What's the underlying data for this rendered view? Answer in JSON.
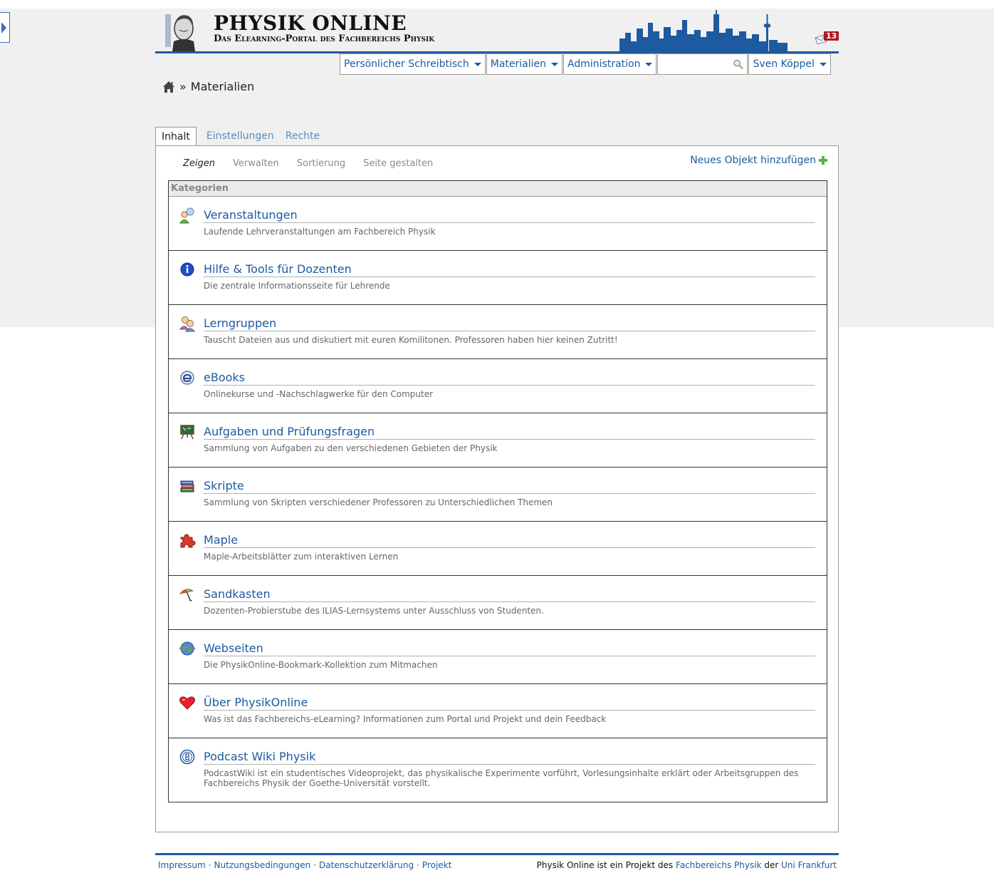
{
  "header": {
    "title": "PHYSIK ONLINE",
    "subtitle": "Das Elearning-Portal des Fachbereichs Physik",
    "mail_count": "13"
  },
  "mainmenu": {
    "desk": "Persönlicher Schreibtisch",
    "materials": "Materialien",
    "admin": "Administration",
    "search_value": "",
    "user": "Sven Köppel"
  },
  "breadcrumb": {
    "sep": "»",
    "current": "Materialien"
  },
  "tabs": [
    {
      "label": "Inhalt"
    },
    {
      "label": "Einstellungen"
    },
    {
      "label": "Rechte"
    }
  ],
  "subtabs": [
    {
      "label": "Zeigen"
    },
    {
      "label": "Verwalten"
    },
    {
      "label": "Sortierung"
    },
    {
      "label": "Seite gestalten"
    }
  ],
  "new_object": "Neues Objekt hinzufügen",
  "categories_header": "Kategorien",
  "categories": [
    {
      "title": "Veranstaltungen",
      "desc": "Laufende Lehrveranstaltungen am Fachbereich Physik",
      "icon": "course-users-icon"
    },
    {
      "title": "Hilfe & Tools für Dozenten",
      "desc": "Die zentrale Informationsseite für Lehrende",
      "icon": "info-icon"
    },
    {
      "title": "Lerngruppen",
      "desc": "Tauscht Dateien aus und diskutiert mit euren Komilitonen. Professoren haben hier keinen Zutritt!",
      "icon": "group-icon"
    },
    {
      "title": "eBooks",
      "desc": "Onlinekurse und -Nachschlagwerke für den Computer",
      "icon": "ebook-icon"
    },
    {
      "title": "Aufgaben und Prüfungsfragen",
      "desc": "Sammlung von Aufgaben zu den verschiedenen Gebieten der Physik",
      "icon": "chalkboard-icon"
    },
    {
      "title": "Skripte",
      "desc": "Sammlung von Skripten verschiedener Professoren zu Unterschiedlichen Themen",
      "icon": "books-icon"
    },
    {
      "title": "Maple",
      "desc": "Maple-Arbeitsblätter zum interaktiven Lernen",
      "icon": "puzzle-icon"
    },
    {
      "title": "Sandkasten",
      "desc": "Dozenten-Probierstube des ILIAS-Lernsystems unter Ausschluss von Studenten.",
      "icon": "umbrella-icon"
    },
    {
      "title": "Webseiten",
      "desc": "Die PhysikOnline-Bookmark-Kollektion zum Mitmachen",
      "icon": "globe-icon"
    },
    {
      "title": "Über PhysikOnline",
      "desc": "Was ist das Fachbereichs-eLearning? Informationen zum Portal und Projekt und dein Feedback",
      "icon": "heart-icon"
    },
    {
      "title": "Podcast Wiki Physik",
      "desc": "PodcastWiki ist ein studentisches Videoprojekt, das physikalische Experimente vorführt, Vorlesungsinhalte erklärt oder Arbeitsgruppen des Fachbereichs Physik der Goethe-Universität vorstellt.",
      "icon": "podcast-icon"
    }
  ],
  "footer": {
    "links": [
      "Impressum",
      "Nutzungsbedingungen",
      "Datenschutzerklärung",
      "Projekt"
    ],
    "dot": "·",
    "right_prefix": "Physik Online ist ein Projekt des",
    "right_link1": "Fachbereichs Physik",
    "right_mid": "der",
    "right_link2": "Uni Frankfurt"
  }
}
